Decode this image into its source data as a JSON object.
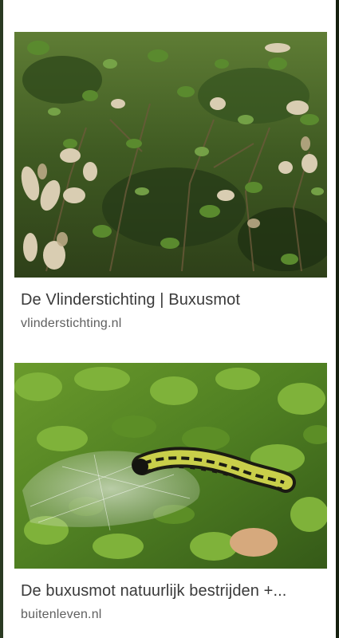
{
  "results": [
    {
      "title": "De Vlinderstichting | Buxusmot",
      "source": "vlinderstichting.nl",
      "image_alt": "Aangetaste buxusstruik met verdorde bladeren"
    },
    {
      "title": "De buxusmot natuurlijk bestrijden +...",
      "source": "buitenleven.nl",
      "image_alt": "Rups van de buxusmot in spinsel op buxus"
    }
  ],
  "colors": {
    "title_text": "#3a3a3a",
    "source_text": "#5f5f5f",
    "background": "#ffffff"
  },
  "icons": {
    "thumbnail_1": "damaged-boxwood-image",
    "thumbnail_2": "caterpillar-image"
  }
}
